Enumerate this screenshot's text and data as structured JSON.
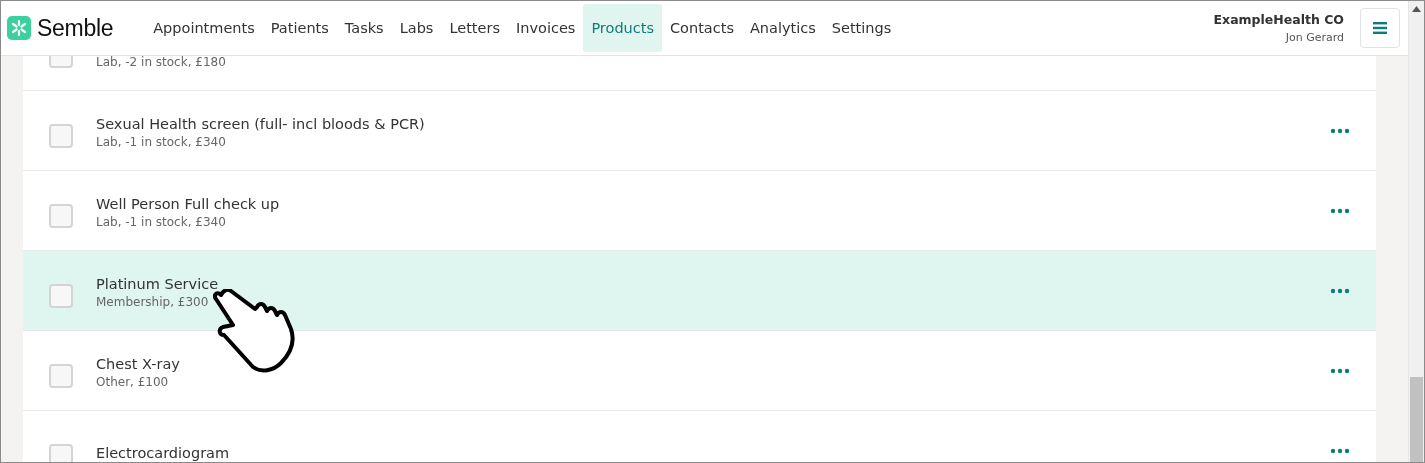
{
  "brand": {
    "name": "Semble"
  },
  "nav": [
    {
      "label": "Appointments",
      "selected": false
    },
    {
      "label": "Patients",
      "selected": false
    },
    {
      "label": "Tasks",
      "selected": false
    },
    {
      "label": "Labs",
      "selected": false
    },
    {
      "label": "Letters",
      "selected": false
    },
    {
      "label": "Invoices",
      "selected": false
    },
    {
      "label": "Products",
      "selected": true
    },
    {
      "label": "Contacts",
      "selected": false
    },
    {
      "label": "Analytics",
      "selected": false
    },
    {
      "label": "Settings",
      "selected": false
    }
  ],
  "account": {
    "organisation": "ExampleHealth CO",
    "user": "Jon Gerard"
  },
  "products": [
    {
      "subtitle": "Lab, -2 in stock, £180",
      "checked": false,
      "selected": false
    },
    {
      "name": "Sexual Health screen (full- incl bloods & PCR)",
      "subtitle": "Lab, -1 in stock, £340",
      "checked": false,
      "selected": false
    },
    {
      "name": "Well Person Full check up",
      "subtitle": "Lab, -1 in stock, £340",
      "checked": false,
      "selected": false
    },
    {
      "name": "Platinum Service",
      "subtitle": "Membership, £300",
      "checked": false,
      "selected": true
    },
    {
      "name": "Chest X-ray",
      "subtitle": "Other, £100",
      "checked": false,
      "selected": false
    },
    {
      "name": "Electrocardiogram",
      "selected": false
    }
  ]
}
